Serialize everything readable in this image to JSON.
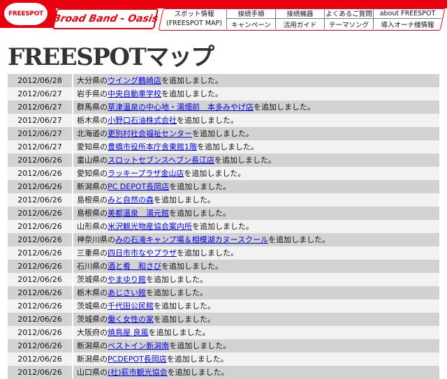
{
  "header": {
    "logo_text": "FREESPOT",
    "brand": "Broad Band - Oasis",
    "nav": {
      "spot_line1": "スポット情報",
      "spot_line2": "(FREESPOT MAP)",
      "top": [
        "接続手順",
        "接続機器",
        "よくあるご質問",
        "about FREESPOT"
      ],
      "bottom": [
        "キャンペーン",
        "活用ガイド",
        "テーマソング",
        "導入オーナ様情報"
      ]
    }
  },
  "page_title": "FREESPOTマップ",
  "suffix": "を追加しました。",
  "rows": [
    {
      "date": "2012/06/28",
      "pref": "大分県の",
      "link": "ウイング鶴崎店"
    },
    {
      "date": "2012/06/27",
      "pref": "岩手県の",
      "link": "中央自動車学校"
    },
    {
      "date": "2012/06/27",
      "pref": "群馬県の",
      "link": "草津温泉の中心地・湯畑前　本多みやげ店"
    },
    {
      "date": "2012/06/27",
      "pref": "栃木県の",
      "link": "小野口石油株式会社"
    },
    {
      "date": "2012/06/27",
      "pref": "北海道の",
      "link": "更別村社会福祉センター"
    },
    {
      "date": "2012/06/27",
      "pref": "愛知県の",
      "link": "豊橋市役所本庁舎東館1階"
    },
    {
      "date": "2012/06/26",
      "pref": "富山県の",
      "link": "スロットセブンスヘブン長江店"
    },
    {
      "date": "2012/06/26",
      "pref": "愛知県の",
      "link": "ラッキープラザ金山店"
    },
    {
      "date": "2012/06/26",
      "pref": "新潟県の",
      "link": "PC DEPOT長岡店"
    },
    {
      "date": "2012/06/26",
      "pref": "島根県の",
      "link": "みと自然の森"
    },
    {
      "date": "2012/06/26",
      "pref": "島根県の",
      "link": "美都温泉　湯元館"
    },
    {
      "date": "2012/06/26",
      "pref": "山形県の",
      "link": "米沢観光物産協会案内所"
    },
    {
      "date": "2012/06/26",
      "pref": "神奈川県の",
      "link": "みの石滝キャンプ場＆相模湖カヌースクール"
    },
    {
      "date": "2012/06/26",
      "pref": "三重県の",
      "link": "四日市市なやプラザ"
    },
    {
      "date": "2012/06/26",
      "pref": "石川県の",
      "link": "酒と肴　和さび"
    },
    {
      "date": "2012/06/26",
      "pref": "茨城県の",
      "link": "やまゆり館"
    },
    {
      "date": "2012/06/26",
      "pref": "栃木県の",
      "link": "あじさい館"
    },
    {
      "date": "2012/06/26",
      "pref": "茨城県の",
      "link": "千代田公民館"
    },
    {
      "date": "2012/06/26",
      "pref": "茨城県の",
      "link": "働く女性の家"
    },
    {
      "date": "2012/06/26",
      "pref": "大阪府の",
      "link": "焼鳥屋 良風"
    },
    {
      "date": "2012/06/26",
      "pref": "新潟県の",
      "link": "ベストイン新潟南"
    },
    {
      "date": "2012/06/26",
      "pref": "新潟県の",
      "link": "PCDEPOT長岡店"
    },
    {
      "date": "2012/06/26",
      "pref": "山口県の",
      "link": "(社)萩市観光協会"
    }
  ]
}
